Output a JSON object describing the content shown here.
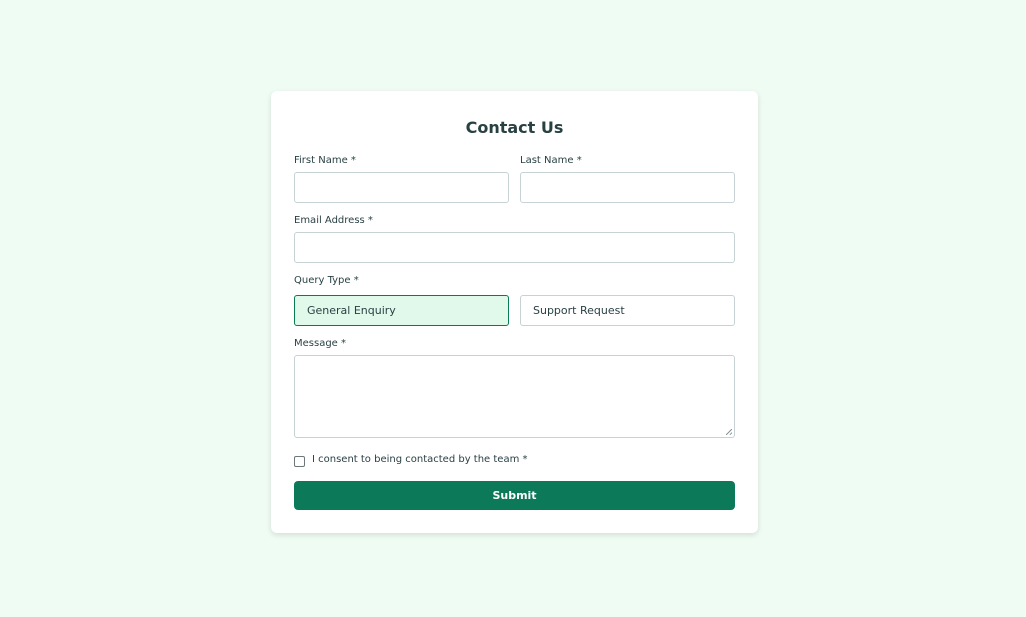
{
  "form": {
    "title": "Contact Us",
    "first_name": {
      "label": "First Name *",
      "value": ""
    },
    "last_name": {
      "label": "Last Name *",
      "value": ""
    },
    "email": {
      "label": "Email Address *",
      "value": ""
    },
    "query_type": {
      "label": "Query Type *",
      "options": [
        "General Enquiry",
        "Support Request"
      ],
      "selected": "General Enquiry"
    },
    "message": {
      "label": "Message *",
      "value": ""
    },
    "consent": {
      "label": "I consent to being contacted by the team *",
      "checked": false
    },
    "submit_label": "Submit"
  },
  "colors": {
    "background": "#effcf3",
    "accent": "#0c7a59",
    "selected_option_bg": "#e0f9ea"
  }
}
